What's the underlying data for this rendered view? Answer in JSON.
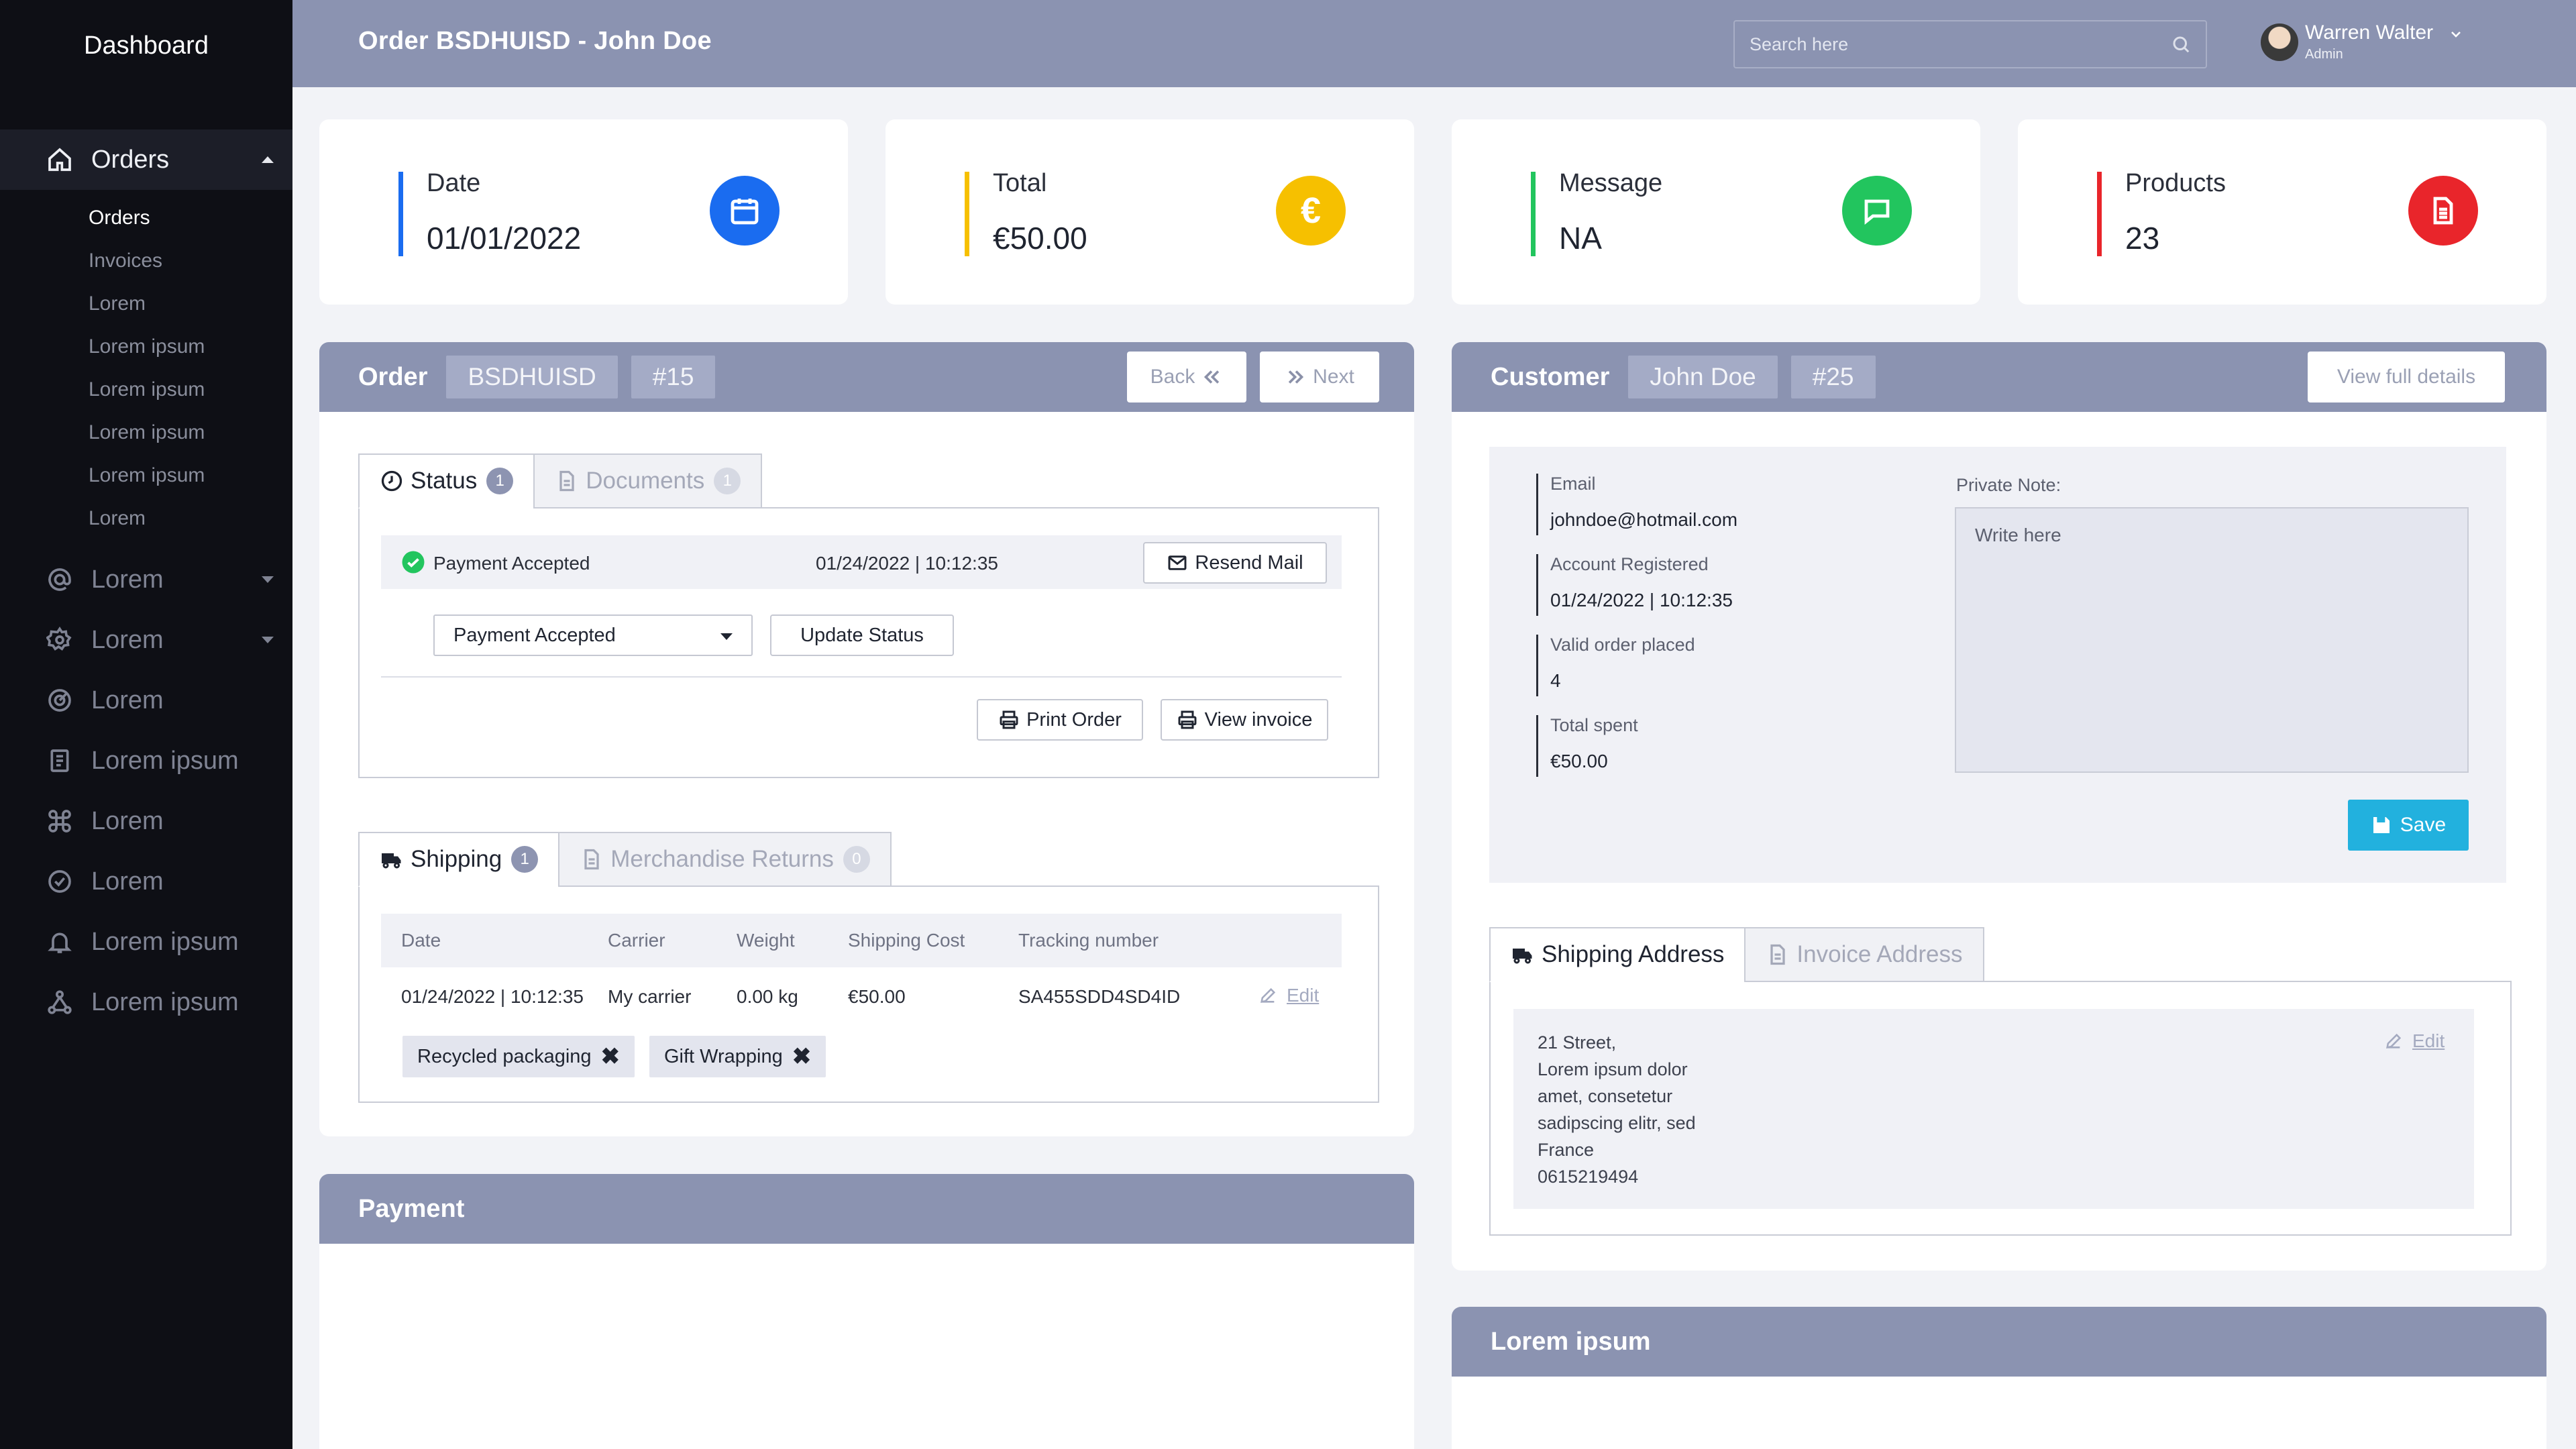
{
  "sidebar": {
    "brand": "Dashboard",
    "active_item": "Orders",
    "sub_items": [
      "Orders",
      "Invoices",
      "Lorem",
      "Lorem ipsum",
      "Lorem ipsum",
      "Lorem ipsum",
      "Lorem ipsum",
      "Lorem"
    ],
    "items": [
      "Lorem",
      "Lorem",
      "Lorem",
      "Lorem ipsum",
      "Lorem",
      "Lorem",
      "Lorem ipsum",
      "Lorem ipsum"
    ]
  },
  "topbar": {
    "title": "Order BSDHUISD - John Doe",
    "search_placeholder": "Search here",
    "user_name": "Warren Walter",
    "user_role": "Admin"
  },
  "stats": [
    {
      "label": "Date",
      "value": "01/01/2022",
      "color": "#1a6cf0",
      "icon": "calendar-icon"
    },
    {
      "label": "Total",
      "value": "€50.00",
      "color": "#f6c000",
      "icon": "euro-icon"
    },
    {
      "label": "Message",
      "value": "NA",
      "color": "#22c55e",
      "icon": "message-icon"
    },
    {
      "label": "Products",
      "value": "23",
      "color": "#e9252b",
      "icon": "document-icon"
    }
  ],
  "order": {
    "title": "Order",
    "code": "BSDHUISD",
    "number": "#15",
    "back_label": "Back",
    "next_label": "Next",
    "status_tab": {
      "label": "Status",
      "count": "1"
    },
    "documents_tab": {
      "label": "Documents",
      "count": "1"
    },
    "current_status": "Payment Accepted",
    "status_datetime": "01/24/2022 | 10:12:35",
    "resend_mail": "Resend Mail",
    "status_select": "Payment Accepted",
    "update_status": "Update Status",
    "print_order": "Print Order",
    "view_invoice": "View invoice",
    "shipping_tab": {
      "label": "Shipping",
      "count": "1"
    },
    "returns_tab": {
      "label": "Merchandise Returns",
      "count": "0"
    },
    "shipping_columns": [
      "Date",
      "Carrier",
      "Weight",
      "Shipping Cost",
      "Tracking number"
    ],
    "shipping_row": [
      "01/24/2022 | 10:12:35",
      "My carrier",
      "0.00 kg",
      "€50.00",
      "SA455SDD4SD4ID"
    ],
    "edit_label": "Edit",
    "tags": [
      "Recycled packaging",
      "Gift Wrapping"
    ]
  },
  "payment": {
    "title": "Payment"
  },
  "customer": {
    "title": "Customer",
    "name": "John Doe",
    "number": "#25",
    "view_details": "View full details",
    "info": [
      {
        "label": "Email",
        "value": "johndoe@hotmail.com"
      },
      {
        "label": "Account Registered",
        "value": "01/24/2022 | 10:12:35"
      },
      {
        "label": "Valid order placed",
        "value": "4"
      },
      {
        "label": "Total spent",
        "value": "€50.00"
      }
    ],
    "note_label": "Private Note:",
    "note_placeholder": "Write here",
    "save_label": "Save",
    "shipping_address_tab": "Shipping Address",
    "invoice_address_tab": "Invoice Address",
    "address_lines": [
      "21 Street,",
      "Lorem ipsum dolor",
      "amet, consetetur",
      "sadipscing elitr, sed",
      "France",
      "0615219494"
    ],
    "edit_label": "Edit"
  },
  "lorem_panel": {
    "title": "Lorem ipsum"
  }
}
